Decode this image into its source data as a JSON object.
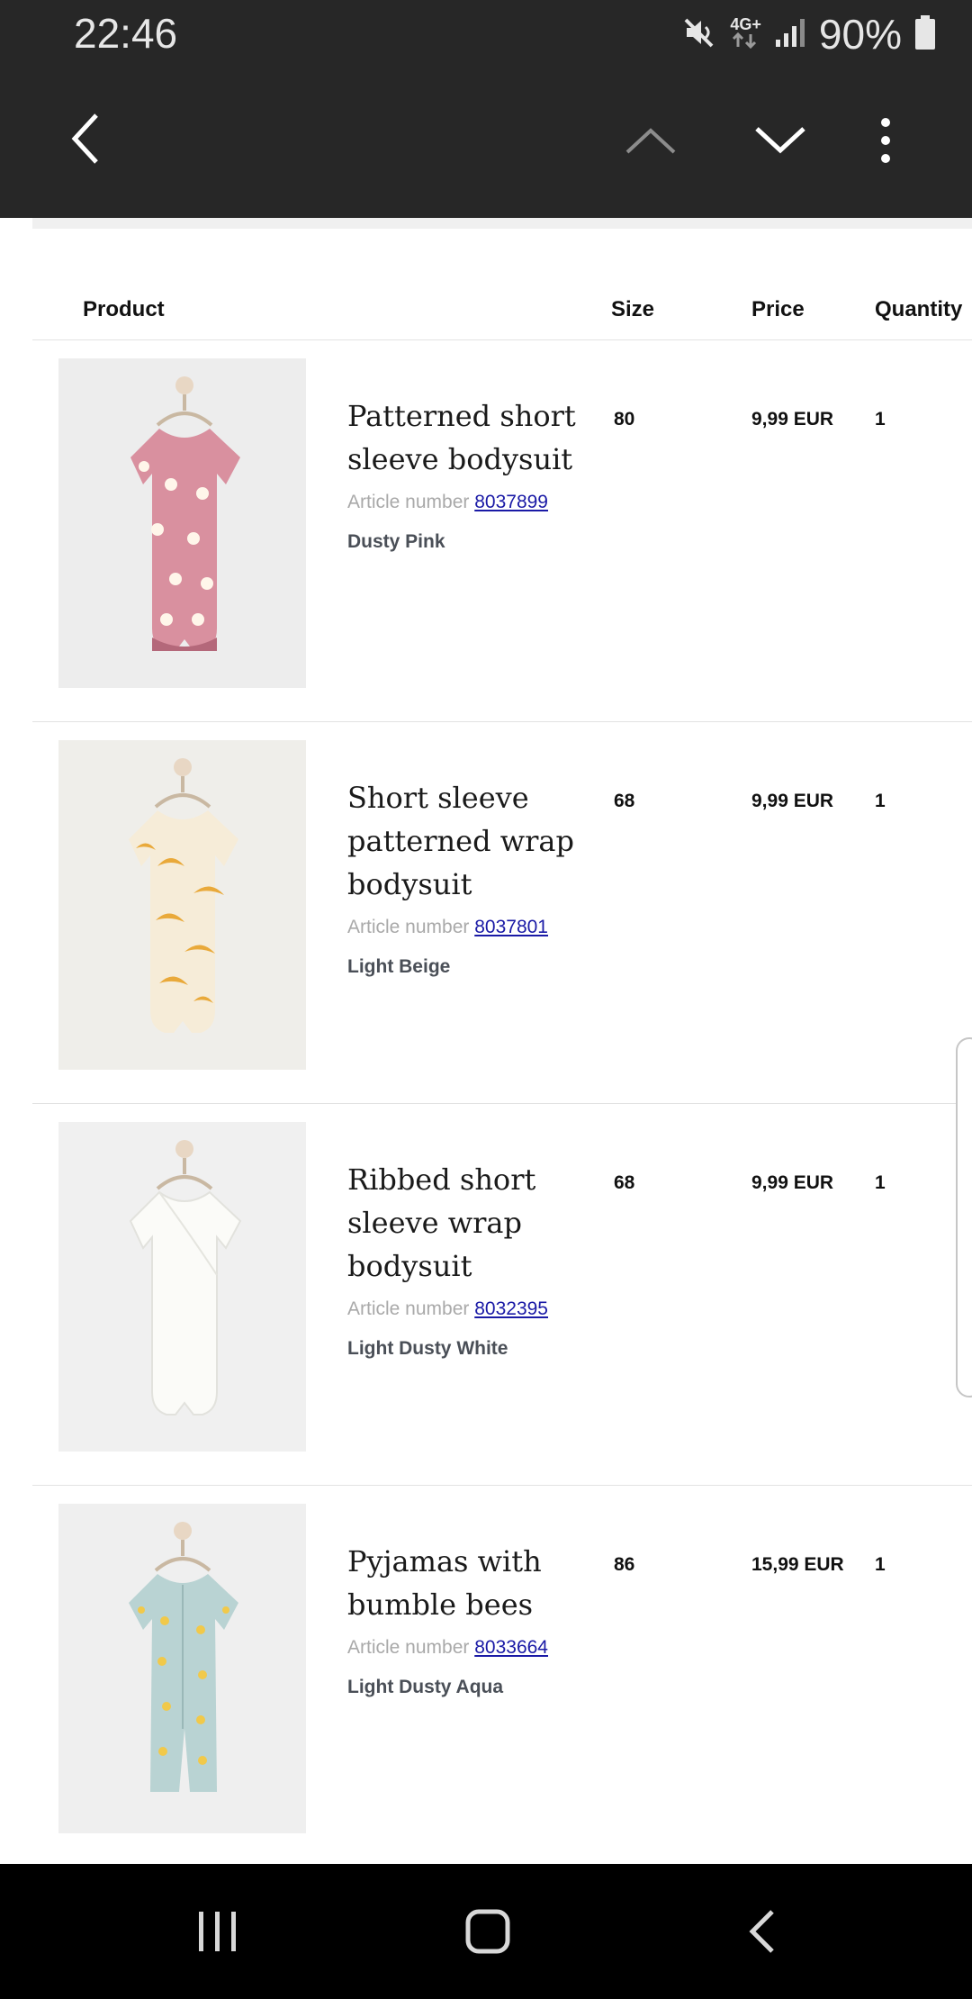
{
  "status_bar": {
    "time": "22:46",
    "network_type": "4G+",
    "battery_percent": "90%"
  },
  "table": {
    "headers": {
      "product": "Product",
      "size": "Size",
      "price": "Price",
      "quantity": "Quantity"
    },
    "article_label": "Article number",
    "rows": [
      {
        "name": "Patterned short sleeve bodysuit",
        "article_number": "8037899",
        "color": "Dusty Pink",
        "size": "80",
        "price": "9,99 EUR",
        "quantity": "1"
      },
      {
        "name": "Short sleeve patterned wrap bodysuit",
        "article_number": "8037801",
        "color": "Light Beige",
        "size": "68",
        "price": "9,99 EUR",
        "quantity": "1"
      },
      {
        "name": "Ribbed short sleeve wrap bodysuit",
        "article_number": "8032395",
        "color": "Light Dusty White",
        "size": "68",
        "price": "9,99 EUR",
        "quantity": "1"
      },
      {
        "name": "Pyjamas with bumble bees",
        "article_number": "8033664",
        "color": "Light Dusty Aqua",
        "size": "86",
        "price": "15,99 EUR",
        "quantity": "1"
      }
    ]
  },
  "icons": {
    "back": "chevron-left-icon",
    "prev": "chevron-up-icon",
    "next": "chevron-down-icon",
    "menu": "more-vert-icon"
  }
}
